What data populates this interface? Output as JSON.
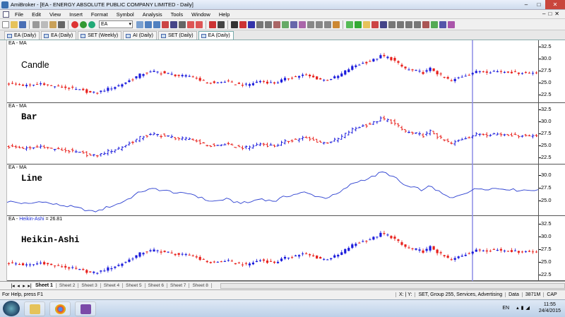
{
  "window": {
    "title": "AmiBroker - [EA - ENERGY ABSOLUTE PUBLIC COMPANY LIMITED  - Daily]",
    "controls": [
      "–",
      "□",
      "✕"
    ]
  },
  "menu": [
    "File",
    "Edit",
    "View",
    "Insert",
    "Format",
    "Symbol",
    "Analysis",
    "Tools",
    "Window",
    "Help"
  ],
  "toolbar": {
    "symbol": "EA"
  },
  "tabs": [
    "EA (Daily)",
    "EA (Daily)",
    "SET (Weekly)",
    "AI (Daily)",
    "SET (Daily)",
    "EA (Daily)"
  ],
  "active_tab": 5,
  "panes": [
    {
      "label": "EA - MA",
      "name": "Candle",
      "style": "candle",
      "ticks": [
        "32.5",
        "30.0",
        "27.5",
        "25.0",
        "22.5"
      ]
    },
    {
      "label": "EA - MA",
      "name": "Bar",
      "style": "bar",
      "ticks": [
        "32.5",
        "30.0",
        "27.5",
        "25.0",
        "22.5"
      ]
    },
    {
      "label": "EA - MA",
      "name": "Line",
      "style": "line",
      "ticks": [
        "30.0",
        "27.5",
        "25.0"
      ]
    },
    {
      "label_prefix": "EA - ",
      "label_highlight": "Heikin-Ashi",
      "label_suffix": " = 26.81",
      "name": "Heikin-Ashi",
      "style": "heikin",
      "ticks": [
        "32.5",
        "30.0",
        "27.5",
        "25.0",
        "22.5"
      ]
    }
  ],
  "sheets": [
    "Sheet 1",
    "Sheet 2",
    "Sheet 3",
    "Sheet 4",
    "Sheet 5",
    "Sheet 6",
    "Sheet 7",
    "Sheet 8"
  ],
  "active_sheet": 0,
  "status": {
    "help": "For Help, press F1",
    "xy": "X: | Y:",
    "info": "SET, Group 255, Services, Advertising",
    "source": "Data",
    "mem": "3871M",
    "cap": "CAP"
  },
  "taskbar": {
    "lang": "EN",
    "time": "11:55",
    "date": "24/4/2015"
  },
  "colors": {
    "up": "#1a1adc",
    "down": "#e8201c",
    "cursor": "#8c8ce6",
    "line": "#2b3fd0"
  },
  "chart_data": {
    "type": "line",
    "title": "",
    "note": "EA price path, approximate closes read from the Line pane",
    "x": [
      0,
      10,
      20,
      30,
      40,
      50,
      60,
      70,
      80,
      90,
      100,
      110,
      120,
      130,
      140,
      150,
      160,
      170,
      180,
      190,
      200,
      210,
      220,
      230,
      240,
      250,
      260,
      270,
      280,
      290,
      300,
      310,
      320,
      330,
      340,
      350,
      360,
      370,
      380,
      390,
      400,
      410,
      420,
      430,
      440,
      450,
      460,
      470,
      480,
      490,
      500,
      510,
      520,
      530,
      540,
      550,
      560,
      570,
      580,
      590,
      600,
      610,
      620,
      630,
      640,
      650,
      660,
      670,
      680,
      690,
      700,
      710,
      720,
      730,
      740,
      750
    ],
    "values": [
      24.8,
      24.7,
      24.5,
      24.3,
      24.6,
      24.9,
      24.4,
      24.2,
      24.0,
      23.8,
      23.5,
      23.2,
      22.8,
      23.0,
      23.6,
      24.0,
      24.5,
      25.2,
      26.0,
      26.8,
      27.1,
      27.3,
      27.0,
      26.8,
      26.5,
      26.3,
      26.4,
      25.8,
      25.2,
      24.8,
      25.0,
      25.3,
      24.8,
      24.6,
      24.5,
      25.0,
      25.4,
      25.0,
      24.9,
      25.6,
      26.0,
      26.3,
      26.6,
      26.2,
      25.8,
      25.5,
      25.9,
      26.4,
      27.5,
      28.4,
      28.9,
      29.3,
      29.8,
      30.6,
      30.2,
      29.4,
      28.2,
      27.6,
      27.4,
      27.0,
      28.0,
      26.8,
      26.0,
      25.3,
      26.1,
      26.6,
      27.1,
      27.4,
      27.3,
      27.4,
      27.3,
      27.3,
      27.0,
      27.1,
      27.0,
      27.2
    ],
    "xlabel": "",
    "ylabel": "",
    "ylim": [
      22.5,
      32.5
    ]
  }
}
